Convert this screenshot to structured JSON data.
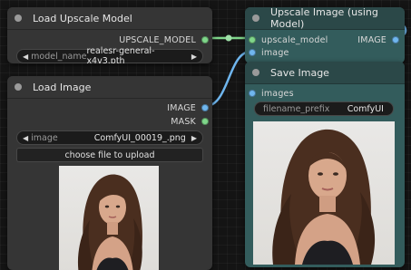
{
  "nodes": {
    "load_upscale_model": {
      "title": "Load Upscale Model",
      "output_label": "UPSCALE_MODEL",
      "model_name_label": "model_name",
      "model_name_value": "realesr-general-x4v3.pth"
    },
    "load_image": {
      "title": "Load Image",
      "output_image_label": "IMAGE",
      "output_mask_label": "MASK",
      "image_label": "image",
      "image_value": "ComfyUI_00019_.png",
      "upload_label": "choose file to upload"
    },
    "upscale_image": {
      "title": "Upscale Image (using Model)",
      "input_model_label": "upscale_model",
      "input_image_label": "image",
      "output_label": "IMAGE"
    },
    "save_image": {
      "title": "Save Image",
      "input_label": "images",
      "filename_prefix_label": "filename_prefix",
      "filename_prefix_value": "ComfyUI"
    }
  },
  "icons": {
    "arrow_left": "left-triangle-icon",
    "arrow_right": "right-triangle-icon",
    "collapse_dot": "node-collapse-dot-icon"
  },
  "colors": {
    "canvas": "#141414",
    "node_gray": "#353535",
    "node_teal": "#335c5c",
    "upscale_model_link": "#7fd68a",
    "image_link": "#6fb6ee"
  }
}
